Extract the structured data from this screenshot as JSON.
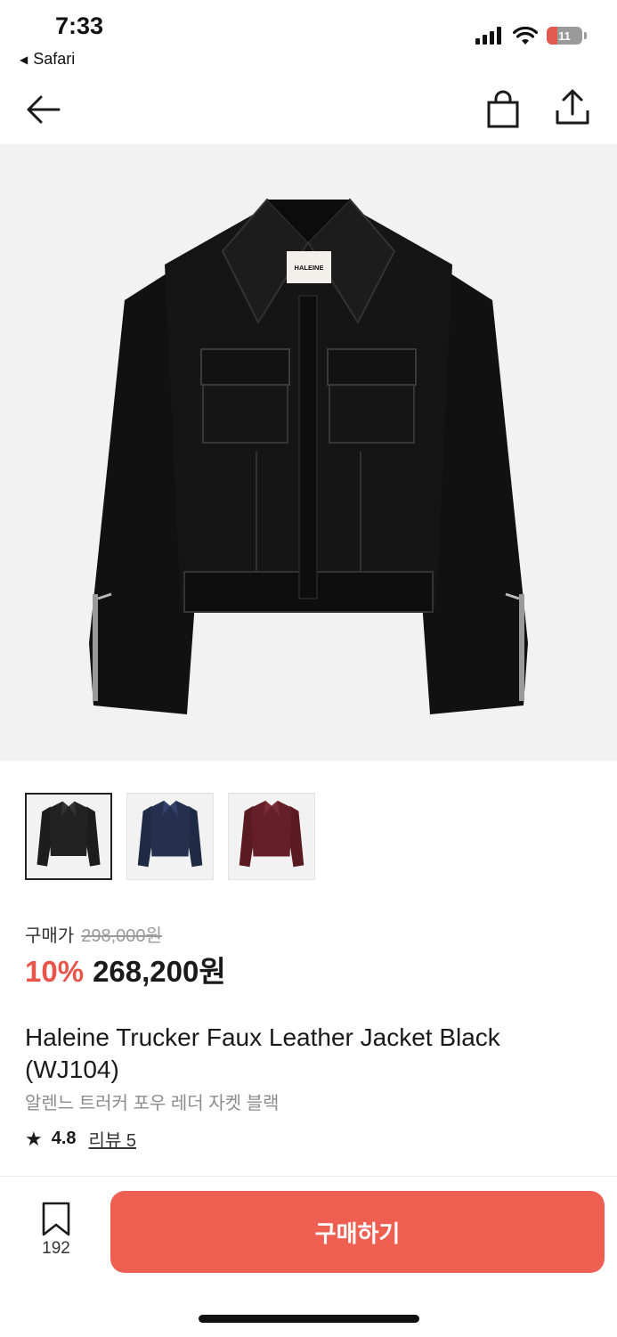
{
  "status_bar": {
    "time": "7:33",
    "back_app": "Safari",
    "battery": "11"
  },
  "navbar": {
    "back_icon": "arrow-left-icon",
    "cart_icon": "shopping-bag-icon",
    "share_icon": "share-icon"
  },
  "hero": {
    "label_text": "HALEINE"
  },
  "thumbnails": [
    {
      "color_name": "black",
      "swatch": "#1d1d1d"
    },
    {
      "color_name": "navy",
      "swatch": "#1f2a44"
    },
    {
      "color_name": "burgundy",
      "swatch": "#5a1a22"
    }
  ],
  "price": {
    "label": "구매가",
    "original": "298,000원",
    "discount": "10%",
    "sale": "268,200원"
  },
  "product": {
    "title": "Haleine Trucker Faux Leather Jacket Black (WJ104)",
    "subtitle": "알렌느 트러커 포우 레더 자켓 블랙",
    "rating": "4.8",
    "review_label": "리뷰 5"
  },
  "bottom": {
    "bookmark_count": "192",
    "buy_label": "구매하기"
  },
  "colors": {
    "accent": "#ee5f51",
    "discount": "#e8534a"
  }
}
